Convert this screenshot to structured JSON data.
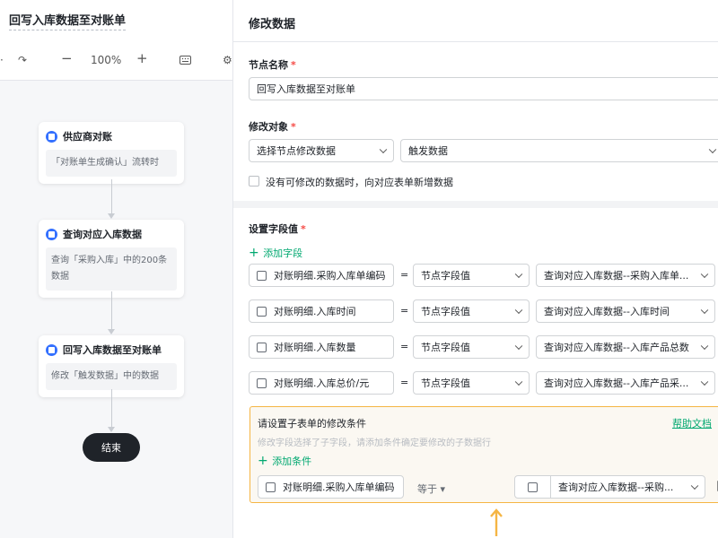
{
  "flow": {
    "title": "回写入库数据至对账单",
    "zoom": "100%",
    "nodes": [
      {
        "title": "供应商对账",
        "desc": "「对账单生成确认」流转时"
      },
      {
        "title": "查询对应入库数据",
        "desc": "查询「采购入库」中的200条数据"
      },
      {
        "title": "回写入库数据至对账单",
        "desc": "修改「触发数据」中的数据"
      }
    ],
    "end_label": "结束"
  },
  "panel": {
    "title": "修改数据",
    "node_name_label": "节点名称",
    "node_name_value": "回写入库数据至对账单",
    "target_label": "修改对象",
    "target_select": "选择节点修改数据",
    "target_value": "触发数据",
    "checkbox_label": "没有可修改的数据时，向对应表单新增数据",
    "fields_label": "设置字段值",
    "add_field": "添加字段",
    "field_rows": [
      {
        "field": "对账明细.采购入库单编码",
        "op": "=",
        "type": "节点字段值",
        "value": "查询对应入库数据--采购入库单..."
      },
      {
        "field": "对账明细.入库时间",
        "op": "=",
        "type": "节点字段值",
        "value": "查询对应入库数据--入库时间"
      },
      {
        "field": "对账明细.入库数量",
        "op": "=",
        "type": "节点字段值",
        "value": "查询对应入库数据--入库产品总数"
      },
      {
        "field": "对账明细.入库总价/元",
        "op": "=",
        "type": "节点字段值",
        "value": "查询对应入库数据--入库产品采..."
      }
    ],
    "condition": {
      "title": "请设置子表单的修改条件",
      "hint": "修改字段选择了子字段，请添加条件确定要修改的子数据行",
      "help": "帮助文档",
      "add_condition": "添加条件",
      "row": {
        "field": "对账明细.采购入库单编码",
        "op": "等于",
        "value": "查询对应入库数据--采购..."
      }
    }
  },
  "colors": {
    "accent_green": "#00a870",
    "highlight_border": "#f5b544",
    "node_icon": "#3370ff",
    "required": "#f54a45"
  }
}
